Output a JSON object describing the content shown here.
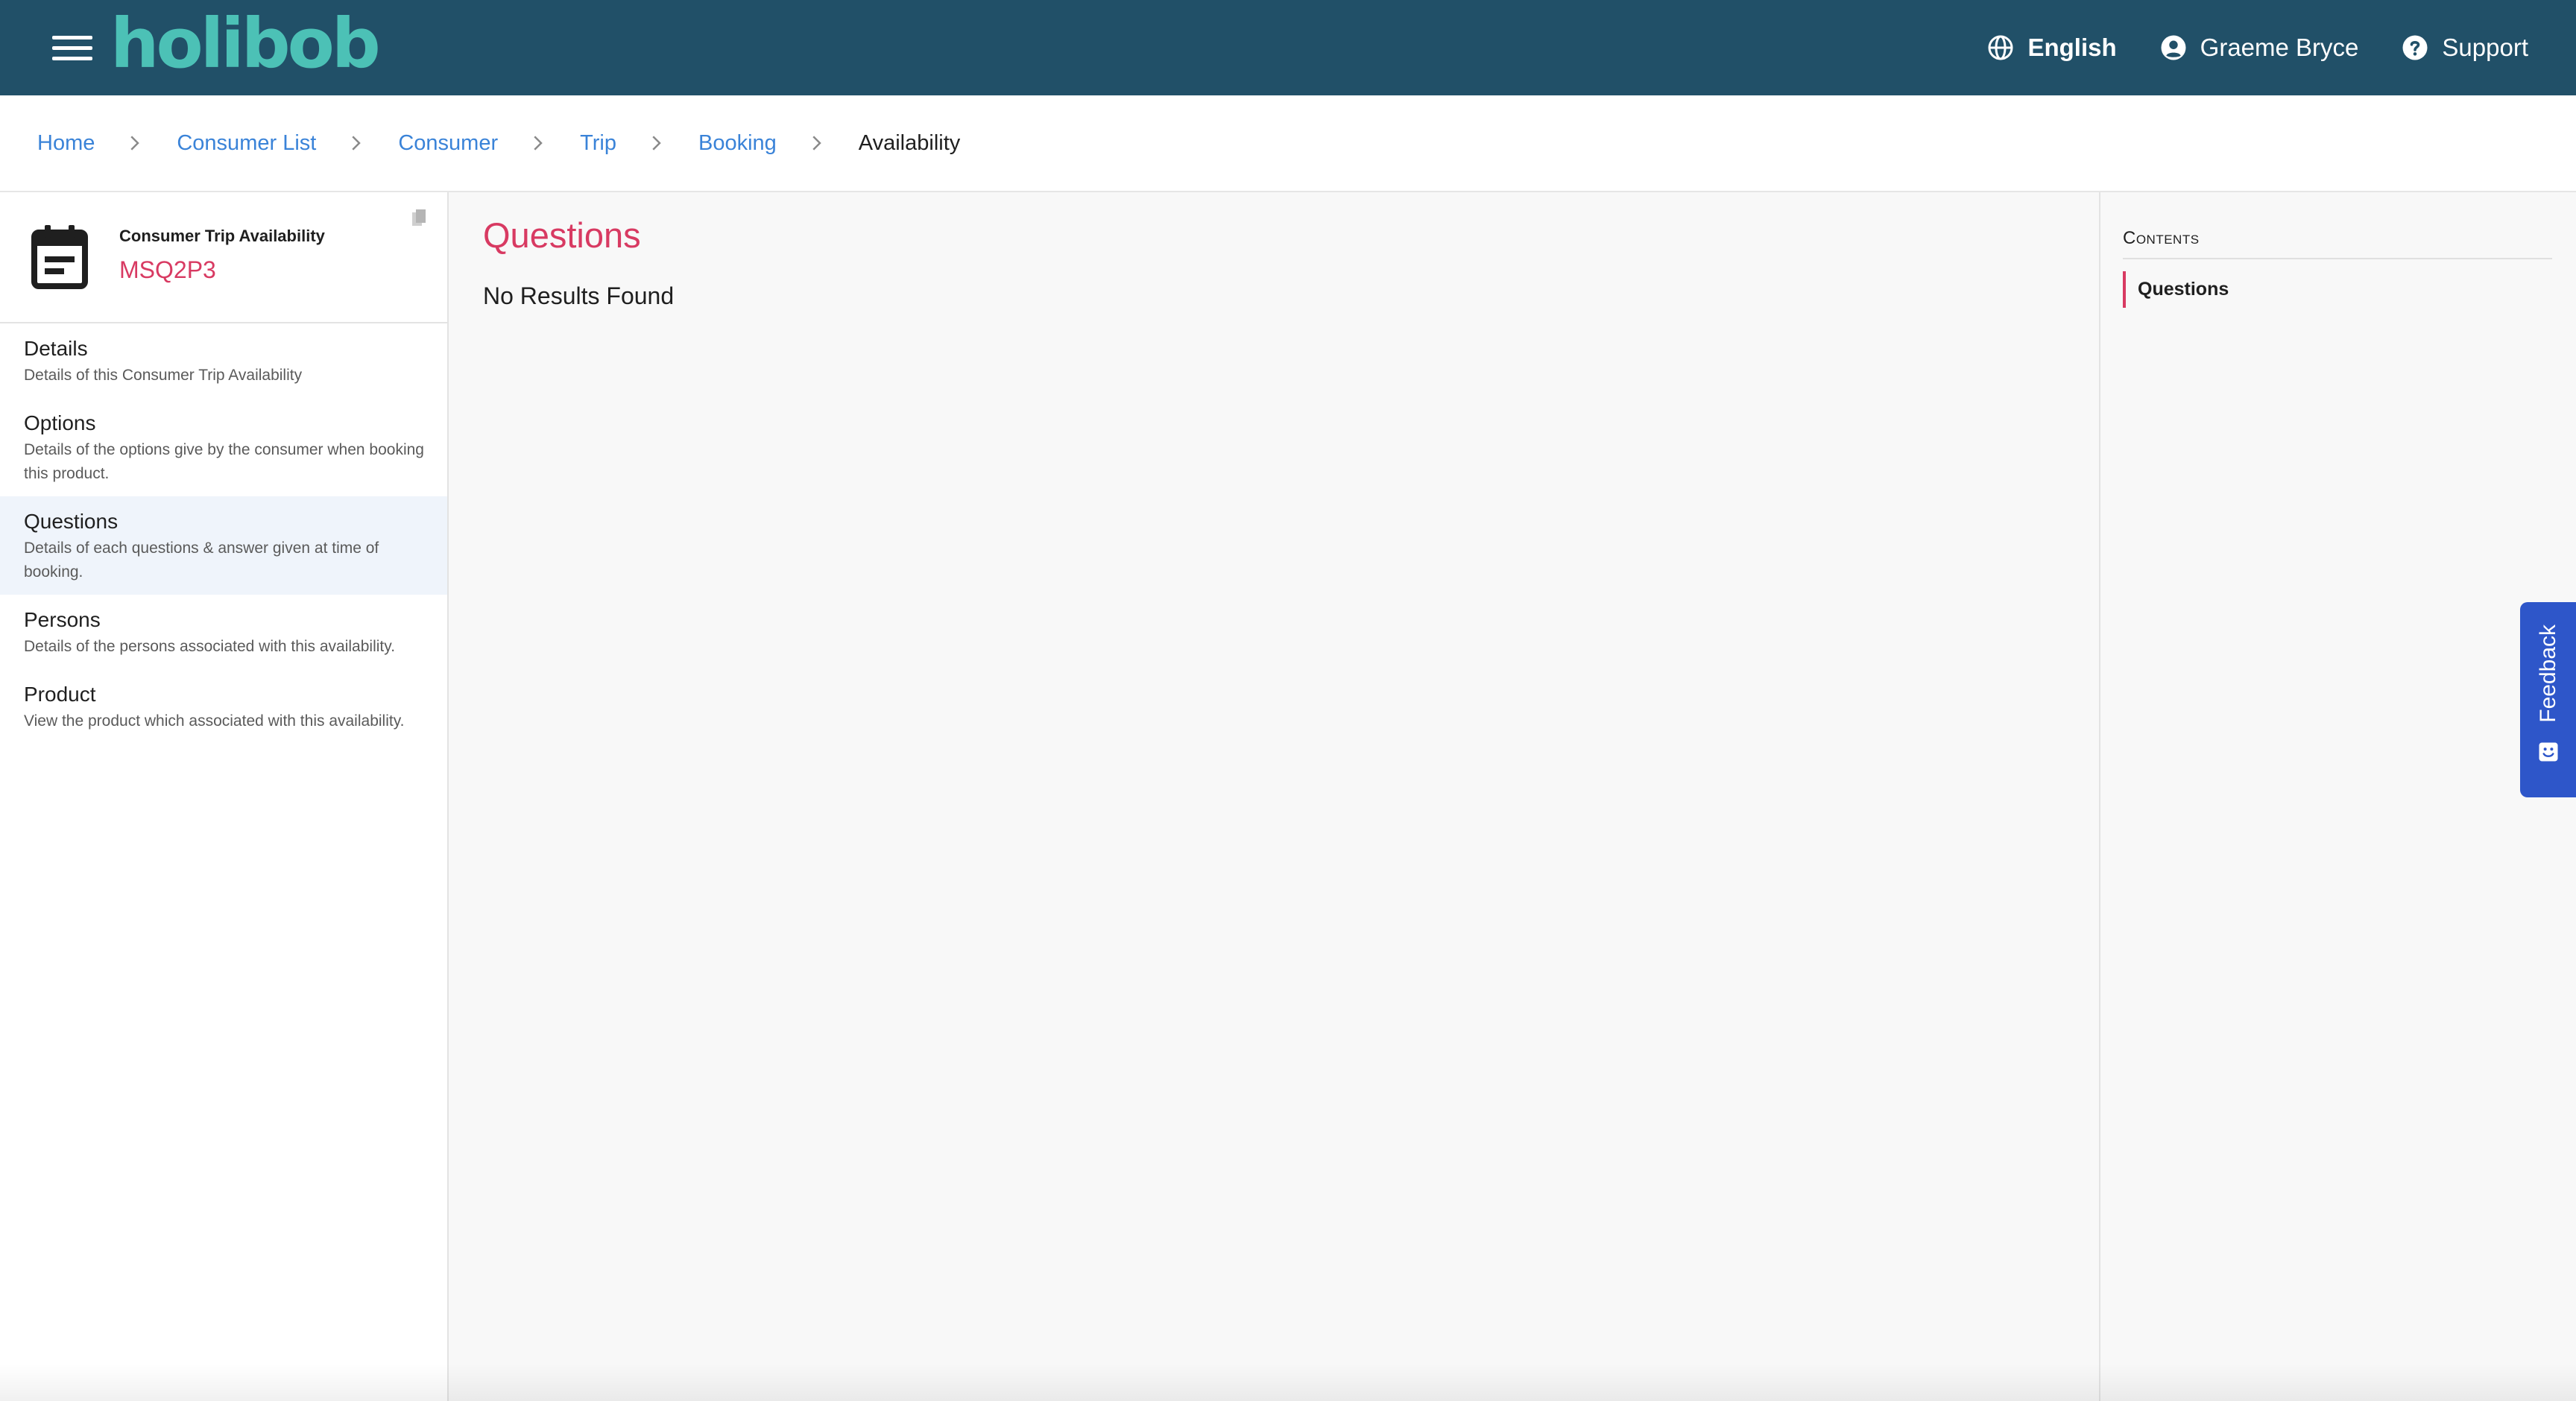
{
  "header": {
    "logo": "holibob",
    "language": "English",
    "user": "Graeme Bryce",
    "support": "Support"
  },
  "breadcrumb": [
    {
      "label": "Home"
    },
    {
      "label": "Consumer List"
    },
    {
      "label": "Consumer"
    },
    {
      "label": "Trip"
    },
    {
      "label": "Booking"
    },
    {
      "label": "Availability"
    }
  ],
  "sidebar": {
    "kicker": "Consumer Trip Availability",
    "code": "MSQ2P3",
    "items": [
      {
        "title": "Details",
        "desc": "Details of this Consumer Trip Availability"
      },
      {
        "title": "Options",
        "desc": "Details of the options give by the consumer when booking this product."
      },
      {
        "title": "Questions",
        "desc": "Details of each questions & answer given at time of booking."
      },
      {
        "title": "Persons",
        "desc": "Details of the persons associated with this availability."
      },
      {
        "title": "Product",
        "desc": "View the product which associated with this availability."
      }
    ]
  },
  "main": {
    "title": "Questions",
    "empty_text": "No Results Found"
  },
  "toc": {
    "heading": "Contents",
    "items": [
      "Questions"
    ]
  },
  "feedback": {
    "label": "Feedback"
  },
  "colors": {
    "topbar": "#215068",
    "logo": "#4cc1b6",
    "accent": "#d83a62",
    "link": "#3a83d8",
    "feedback": "#2e56c9"
  }
}
